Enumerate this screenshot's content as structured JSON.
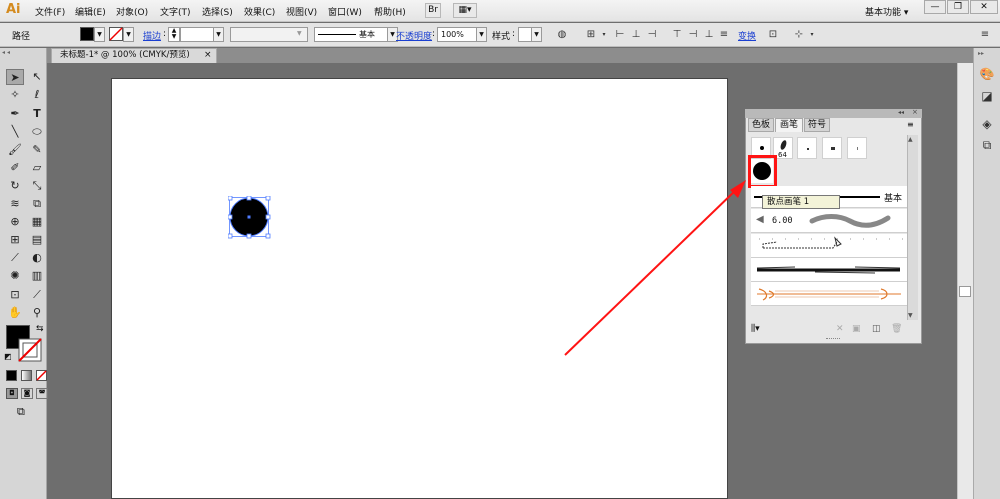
{
  "app": {
    "logo": "Ai",
    "menus": [
      "文件(F)",
      "编辑(E)",
      "对象(O)",
      "文字(T)",
      "选择(S)",
      "效果(C)",
      "视图(V)",
      "窗口(W)",
      "帮助(H)"
    ],
    "bridge_label": "Br",
    "arrange_label": "▦▾",
    "workspace": "基本功能",
    "workspace_arrow": "▾",
    "window_buttons": [
      "—",
      "❐",
      "✕"
    ]
  },
  "control_bar": {
    "selection_label": "路径",
    "stroke_link": "描边",
    "stroke_weight_value": "",
    "variable_width_value": "",
    "brush_label": "基本",
    "opacity_link": "不透明度",
    "opacity_value": "100%",
    "style_label": "样式",
    "transform_link": "变换",
    "colors": {
      "fill": "#000000",
      "stroke": "none"
    }
  },
  "document": {
    "tab_title": "未标题-1* @ 100% (CMYK/预览)",
    "tab_close": "×"
  },
  "brush_panel": {
    "tabs": [
      "色板",
      "画笔",
      "符号"
    ],
    "active_tab": "画笔",
    "size_label": "64",
    "tooltip": "散点画笔 1",
    "basic_label": "基本",
    "stroke_size": "6.00",
    "menu_icon": "≡"
  },
  "icons": [
    "selection-tool-icon",
    "direct-selection-icon",
    "pen-icon",
    "type-icon",
    "line-icon",
    "ellipse-icon",
    "paintbrush-icon",
    "pencil-icon",
    "eraser-icon",
    "rotate-icon",
    "scale-icon",
    "warp-icon",
    "free-transform-icon",
    "shape-builder-icon",
    "perspective-icon",
    "mesh-icon",
    "gradient-icon",
    "eyedropper-icon",
    "blend-icon",
    "symbol-sprayer-icon",
    "column-graph-icon",
    "artboard-icon",
    "slice-icon",
    "hand-icon",
    "zoom-icon",
    "color-icon",
    "color-guide-icon",
    "layers-icon",
    "transparency-icon"
  ],
  "accent_colors": {
    "annotation_red": "#ff1414",
    "link_blue": "#1a3fd1",
    "selection_blue": "#4f7cff"
  }
}
